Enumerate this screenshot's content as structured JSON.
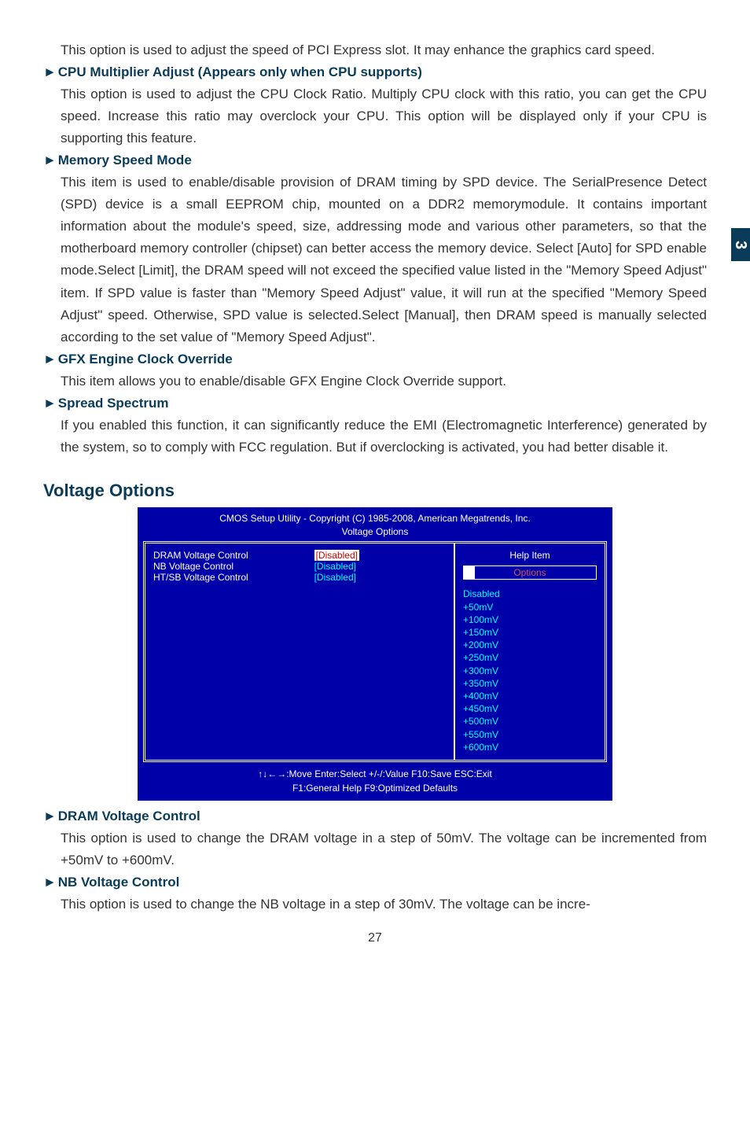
{
  "sideTab": "3",
  "pageNumber": "27",
  "intro": "This option is used to adjust the speed of PCI Express slot. It may enhance the graphics card speed.",
  "sections": [
    {
      "title": "CPU Multiplier Adjust (Appears only when CPU supports)",
      "body": "This option is used to adjust the CPU Clock Ratio. Multiply CPU clock with this ratio, you can get the CPU speed. Increase this ratio may overclock your CPU. This option will be displayed only if your CPU is supporting this feature."
    },
    {
      "title": "Memory Speed Mode",
      "body": "This item is used to enable/disable provision of DRAM timing by SPD device. The SerialPresence Detect (SPD) device is a small EEPROM chip, mounted on a DDR2 memorymodule. It contains important information about the module's speed, size, addressing mode and various other parameters, so that the motherboard memory controller (chipset) can better access the memory device. Select [Auto] for SPD enable mode.Select [Limit], the DRAM speed will not exceed the specified value listed in the \"Memory Speed Adjust\" item. If SPD value is faster than \"Memory Speed Adjust\" value, it will run at the specified \"Memory Speed Adjust\" speed. Otherwise, SPD value is selected.Select [Manual], then DRAM speed is manually selected according to the set value of \"Memory Speed Adjust\"."
    },
    {
      "title": "GFX Engine Clock Override",
      "body": "This item allows you to enable/disable GFX Engine Clock Override support."
    },
    {
      "title": "Spread Spectrum",
      "body": "If you enabled this function, it can significantly reduce the EMI (Electromagnetic Interference) generated by the system, so to comply with FCC regulation. But if overclocking is activated, you had better disable it."
    }
  ],
  "voltageTitle": "Voltage Options",
  "bios": {
    "titleLine1": "CMOS Setup Utility - Copyright (C) 1985-2008, American Megatrends, Inc.",
    "titleLine2": "Voltage Options",
    "items": [
      {
        "label": "DRAM Voltage Control",
        "value": "[Disabled]",
        "selected": true
      },
      {
        "label": "NB Voltage Control",
        "value": "[Disabled]",
        "selected": false
      },
      {
        "label": "HT/SB Voltage Control",
        "value": "[Disabled]",
        "selected": false
      }
    ],
    "helpTitle": "Help Item",
    "optionsLabel": "Options",
    "options": [
      "Disabled",
      "+50mV",
      "+100mV",
      "+150mV",
      "+200mV",
      "+250mV",
      "+300mV",
      "+350mV",
      "+400mV",
      "+450mV",
      "+500mV",
      "+550mV",
      "+600mV"
    ],
    "footer1": "↑↓←→:Move   Enter:Select    +/-/:Value    F10:Save      ESC:Exit",
    "footer2": "F1:General Help                     F9:Optimized Defaults"
  },
  "postSections": [
    {
      "title": "DRAM Voltage Control",
      "body": "This option is used to change the DRAM voltage in a step of 50mV. The voltage can be incremented from +50mV to +600mV."
    },
    {
      "title": "NB Voltage Control",
      "body": "This option is used to change the NB voltage in a step of 30mV. The voltage can be incre-"
    }
  ]
}
